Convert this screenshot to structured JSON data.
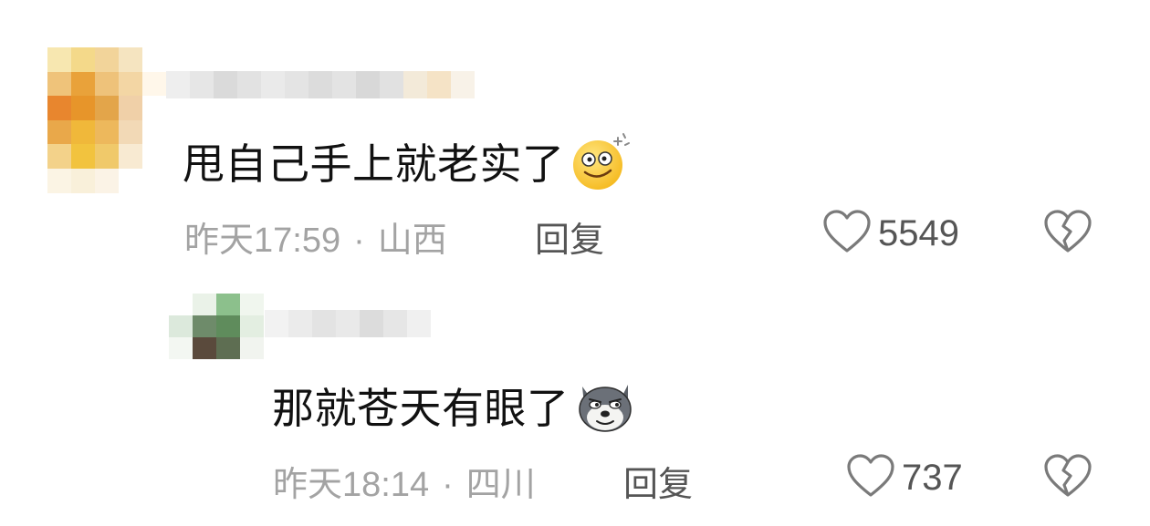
{
  "comments": [
    {
      "text": "甩自己手上就老实了",
      "emoji": "dizzy-smile-emoji",
      "time": "昨天17:59",
      "location": "山西",
      "reply_label": "回复",
      "likes": "5549",
      "colors": {
        "avatar": [
          "#f7e7b0",
          "#f4d98a",
          "#f2d49a",
          "#f5e4c0",
          "#ffffff",
          "#efc37a",
          "#e9a23a",
          "#eec27a",
          "#f3d6a4",
          "#fff7ea",
          "#e8862e",
          "#e7952a",
          "#e3a54a",
          "#f0d0a8",
          "#ffffff",
          "#e9a84a",
          "#f0b83a",
          "#edb85c",
          "#f2d9b6",
          "#ffffff",
          "#f3d28a",
          "#f2c33e",
          "#f0c96a",
          "#f8ead2",
          "#ffffff",
          "#fbf4e4",
          "#f9f0da",
          "#fbf3e6",
          "#ffffff",
          "#ffffff"
        ],
        "username": [
          "#eeeeee",
          "#e6e6e6",
          "#dadada",
          "#e2e2e2",
          "#eaeaea",
          "#e4e4e4",
          "#dcdcdc",
          "#e3e3e3",
          "#d8d8d8",
          "#e1e1e1",
          "#f3ead9",
          "#f5e3c6",
          "#f8f2e8"
        ]
      }
    },
    {
      "text": "那就苍天有眼了",
      "emoji": "dog-face-emoji",
      "time": "昨天18:14",
      "location": "四川",
      "reply_label": "回复",
      "likes": "737",
      "colors": {
        "avatar": [
          "#ffffff",
          "#eaf2e8",
          "#8cc08c",
          "#f0f6ee",
          "#dce9dc",
          "#6e8b6a",
          "#5f8c5c",
          "#e3eee1",
          "#f3f7f2",
          "#5a4a3c",
          "#5e6e52",
          "#f1f4ef"
        ],
        "username": [
          "#f2f2f2",
          "#ebebeb",
          "#e3e3e3",
          "#e9e9e9",
          "#dcdcdc",
          "#e6e6e6",
          "#f0f0f0"
        ]
      }
    }
  ],
  "separator": "·",
  "colors": {
    "text": "#111111",
    "meta": "#a3a3a3",
    "action": "#555555"
  }
}
